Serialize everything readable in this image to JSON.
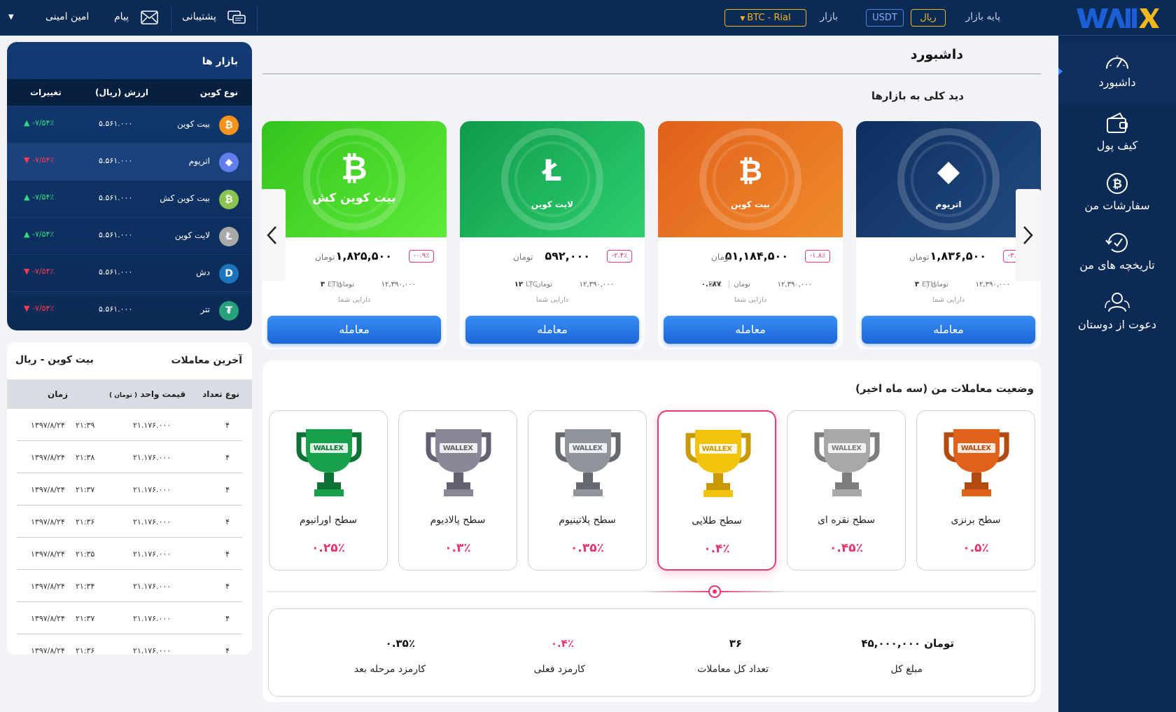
{
  "topbar": {
    "logo_text": "WALLEX",
    "base_market_label": "پایه بازار",
    "base_rial": "ریال",
    "base_usdt": "USDT",
    "market_label": "بازار",
    "market_select": "BTC - Rial",
    "support_label": "پشتیبانی",
    "message_label": "پیام",
    "user_name": "امین امینی"
  },
  "sidenav": {
    "items": [
      {
        "label": "داشبورد",
        "icon": "gauge-icon"
      },
      {
        "label": "کیف پول",
        "icon": "wallet-icon"
      },
      {
        "label": "سفارشات من",
        "icon": "bitcoin-circle-icon"
      },
      {
        "label": "تاریخچه های من",
        "icon": "history-icon"
      },
      {
        "label": "دعوت از دوستان",
        "icon": "users-icon"
      }
    ]
  },
  "markets": {
    "title": "بازار ها",
    "headers": {
      "coin": "نوع کوین",
      "value": "ارزش (ریال)",
      "change": "تغییرات"
    },
    "rows": [
      {
        "name": "بیت کوین",
        "price": "۵.۵۶۱.۰۰۰",
        "change": "-۷/۵۴٪",
        "dir": "up",
        "color": "#f7931a",
        "symbol": "₿"
      },
      {
        "name": "اتریوم",
        "price": "۵.۵۶۱.۰۰۰",
        "change": "-۷/۵۴٪",
        "dir": "down",
        "color": "#627eea",
        "symbol": "◆"
      },
      {
        "name": "بیت کوین کش",
        "price": "۵.۵۶۱.۰۰۰",
        "change": "-۷/۵۴٪",
        "dir": "up",
        "color": "#8dc351",
        "symbol": "₿"
      },
      {
        "name": "لایت کوین",
        "price": "۵.۵۶۱.۰۰۰",
        "change": "-۷/۵۴٪",
        "dir": "up",
        "color": "#a9a9a9",
        "symbol": "Ł"
      },
      {
        "name": "دش",
        "price": "۵.۵۶۱.۰۰۰",
        "change": "-۷/۵۴٪",
        "dir": "down",
        "color": "#1c75bc",
        "symbol": "D"
      },
      {
        "name": "تتر",
        "price": "۵.۵۶۱.۰۰۰",
        "change": "-۷/۵۴٪",
        "dir": "down",
        "color": "#26a17b",
        "symbol": "₮"
      }
    ]
  },
  "trades": {
    "title": "آخرین معاملات",
    "pair": "بیت کوین - ریال",
    "headers": {
      "qty": "نوع تعداد",
      "unit_price": "قیمت واحد",
      "unit_price_sub": "( تومان )",
      "time": "زمان"
    },
    "rows": [
      {
        "qty": "۴",
        "price": "۲۱.۱۷۶.۰۰۰",
        "time": "۲۱:۳۹",
        "date": "۱۳۹۷/۸/۲۴"
      },
      {
        "qty": "۴",
        "price": "۲۱.۱۷۶.۰۰۰",
        "time": "۲۱:۳۸",
        "date": "۱۳۹۷/۸/۲۴"
      },
      {
        "qty": "۴",
        "price": "۲۱.۱۷۶.۰۰۰",
        "time": "۲۱:۳۷",
        "date": "۱۳۹۷/۸/۲۴"
      },
      {
        "qty": "۴",
        "price": "۲۱.۱۷۶.۰۰۰",
        "time": "۲۱:۳۶",
        "date": "۱۳۹۷/۸/۲۴"
      },
      {
        "qty": "۴",
        "price": "۲۱.۱۷۶.۰۰۰",
        "time": "۲۱:۳۵",
        "date": "۱۳۹۷/۸/۲۴"
      },
      {
        "qty": "۴",
        "price": "۲۱.۱۷۶.۰۰۰",
        "time": "۲۱:۳۴",
        "date": "۱۳۹۷/۸/۲۴"
      },
      {
        "qty": "۴",
        "price": "۲۱.۱۷۶.۰۰۰",
        "time": "۲۱:۳۷",
        "date": "۱۳۹۷/۸/۲۴"
      },
      {
        "qty": "۴",
        "price": "۲۱.۱۷۶.۰۰۰",
        "time": "۲۱:۳۶",
        "date": "۱۳۹۷/۸/۲۴"
      }
    ]
  },
  "dashboard": {
    "title": "داشبورد",
    "overview_title": "دید کلی به بازارها",
    "cards": [
      {
        "title": "اتریوم",
        "price": "۱,۸۳۶,۵۰۰",
        "unit": "تومان",
        "change": "-۳.۷٪",
        "holding_value": "۱۲,۳۹۰,۰۰۰",
        "holding_unit": "تومان",
        "holding_amount": "۳",
        "holding_symbol": "ETH",
        "holding_label": "دارایی شما",
        "button": "معامله",
        "bg1": "#0d2f5f",
        "bg2": "#234a80",
        "glyph": "◆"
      },
      {
        "title": "بیت کوین",
        "price": "۵۱,۱۸۴,۵۰۰",
        "unit": "تومان",
        "change": "-۱.۸٪",
        "holding_value": "۱۲,۳۹۰,۰۰۰",
        "holding_unit": "تومان",
        "holding_amount": "۰.۰۸۷",
        "holding_symbol": "BTC",
        "holding_label": "دارایی شما",
        "button": "معامله",
        "bg1": "#e0611a",
        "bg2": "#f08a2c",
        "glyph": "₿"
      },
      {
        "title": "لایت کوین",
        "price": "۵۹۲,۰۰۰",
        "unit": "تومان",
        "change": "-۲.۴٪",
        "holding_value": "۱۲,۳۹۰,۰۰۰",
        "holding_unit": "تومان",
        "holding_amount": "۱۲",
        "holding_symbol": "LTC",
        "holding_label": "دارایی شما",
        "button": "معامله",
        "bg1": "#0f9a4c",
        "bg2": "#2ecf6e",
        "glyph": "Ł"
      },
      {
        "title": "بیت کوین کش",
        "price": "۱,۸۲۵,۵۰۰",
        "unit": "تومان",
        "change": "-۰.۹٪",
        "holding_value": "۱۲,۳۹۰,۰۰۰",
        "holding_unit": "تومان",
        "holding_amount": "۳",
        "holding_symbol": "ETH",
        "holding_label": "دارایی شما",
        "button": "معامله",
        "bg1": "#33c41c",
        "bg2": "#5eea3a",
        "glyph": "₿"
      }
    ]
  },
  "status": {
    "title": "وضعیت معاملات من (سه ماه اخیر)",
    "levels": [
      {
        "name": "سطح برنزی",
        "pct": "۰.۵٪",
        "color": "#e0621a",
        "dark": "#b34a10"
      },
      {
        "name": "سطح نقره ای",
        "pct": "۰.۴۵٪",
        "color": "#a8a8a8",
        "dark": "#7d7d7d"
      },
      {
        "name": "سطح طلایی",
        "pct": "۰.۴٪",
        "color": "#f2c20c",
        "dark": "#c99a00"
      },
      {
        "name": "سطح پلاتینیوم",
        "pct": "۰.۳۵٪",
        "color": "#8f959b",
        "dark": "#646a70"
      },
      {
        "name": "سطح پالادیوم",
        "pct": "۰.۳٪",
        "color": "#8c8796",
        "dark": "#65606f"
      },
      {
        "name": "سطح اورانیوم",
        "pct": "۰.۲۵٪",
        "color": "#18a14a",
        "dark": "#0d7334"
      }
    ],
    "active_level": 2,
    "summary": {
      "total_amount_value": "۴۵,۰۰۰,۰۰۰ تومان",
      "total_amount_label": "مبلغ کل",
      "total_trades_value": "۳۶",
      "total_trades_label": "تعداد کل معاملات",
      "current_fee_value": "۰.۴٪",
      "current_fee_label": "کارمزد فعلی",
      "next_fee_value": "۰.۳۵٪",
      "next_fee_label": "کارمزد مرحله بعد"
    }
  },
  "colors": {
    "nav": "#0b2a55",
    "accent": "#e8336b",
    "button": "#1a66d6"
  }
}
